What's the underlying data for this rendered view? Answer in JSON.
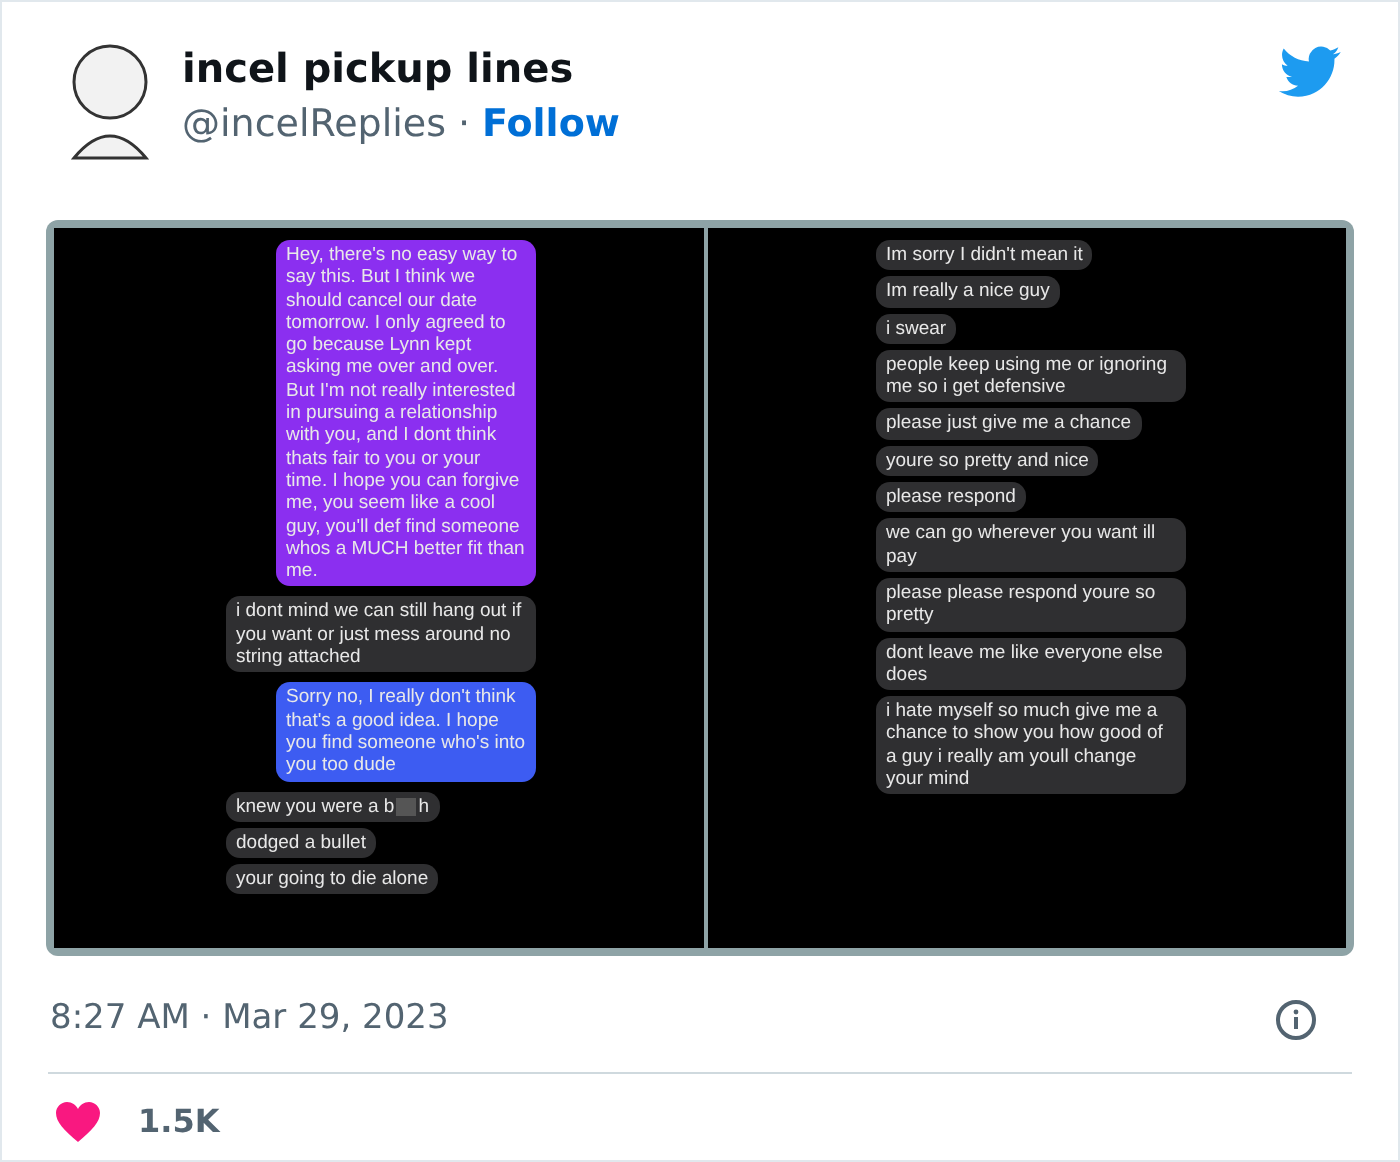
{
  "tweet": {
    "name": "incel pickup lines",
    "handle": "@incelReplies",
    "separator": "·",
    "follow": "Follow",
    "timestamp": "8:27 AM · Mar 29, 2023",
    "likes": "1.5K"
  },
  "screenshot": {
    "left": [
      {
        "kind": "sent",
        "text": "Hey, there's no easy way to say this. But I think we should cancel our date tomorrow. I only agreed to go because Lynn kept asking me over and over. But I'm not really interested in pursuing a relationship with you, and I dont think thats fair to you or your time. I hope you can forgive me, you seem like a cool guy, you'll def find someone whos a MUCH better fit than me.",
        "color": "#8b2ff0"
      },
      {
        "kind": "received",
        "text": "i dont mind we can still hang out if you want or just mess around no string attached"
      },
      {
        "kind": "sent",
        "text": "Sorry no, I really don't think that's a good idea. I hope you find someone who's into you too dude",
        "color": "#3d5cf2"
      },
      {
        "kind": "received",
        "text": "knew you were a b",
        "text_after": "h"
      },
      {
        "kind": "received",
        "text": "dodged a bullet"
      },
      {
        "kind": "received",
        "text": "your going to die alone"
      }
    ],
    "right": [
      {
        "kind": "received",
        "text": "Im sorry I didn't mean it"
      },
      {
        "kind": "received",
        "text": "Im really a nice guy"
      },
      {
        "kind": "received",
        "text": "i swear"
      },
      {
        "kind": "received",
        "text": "people keep using me or ignoring me so i get defensive"
      },
      {
        "kind": "received",
        "text": "please just give me a chance"
      },
      {
        "kind": "received",
        "text": "youre so pretty and nice"
      },
      {
        "kind": "received",
        "text": "please respond"
      },
      {
        "kind": "received",
        "text": "we can go wherever you want ill pay"
      },
      {
        "kind": "received",
        "text": "please please respond youre so pretty"
      },
      {
        "kind": "received",
        "text": "dont leave me like everyone else does"
      },
      {
        "kind": "received",
        "text": "i hate myself so much give me a chance to show you how good of a guy i really am youll change your mind"
      }
    ]
  }
}
